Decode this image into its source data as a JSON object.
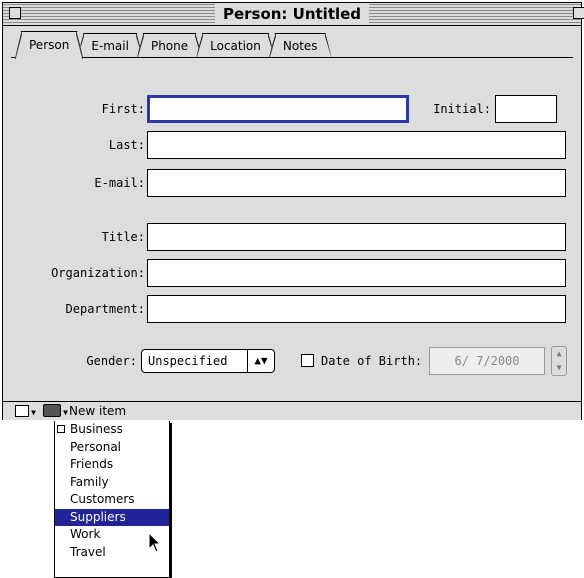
{
  "window": {
    "title": "Person: Untitled",
    "tabs": [
      "Person",
      "E-mail",
      "Phone",
      "Location",
      "Notes"
    ],
    "active_tab": "Person"
  },
  "form": {
    "first_label": "First:",
    "first_value": "",
    "initial_label": "Initial:",
    "initial_value": "",
    "last_label": "Last:",
    "last_value": "",
    "email_label": "E-mail:",
    "email_value": "",
    "title_label": "Title:",
    "title_value": "",
    "organization_label": "Organization:",
    "organization_value": "",
    "department_label": "Department:",
    "department_value": "",
    "gender_label": "Gender:",
    "gender_value": "Unspecified",
    "dob_label": "Date of Birth:",
    "dob_value": "6/ 7/2000",
    "dob_checked": false
  },
  "bottombar": {
    "status_text": "New item"
  },
  "category_menu": {
    "items": [
      "Business",
      "Personal",
      "Friends",
      "Family",
      "Customers",
      "Suppliers",
      "Work",
      "Travel"
    ],
    "checked_item": "Business",
    "highlighted_item": "Suppliers"
  },
  "colors": {
    "window_bg": "#dddddd",
    "focus_ring": "#2c37a8",
    "menu_highlight": "#23239a"
  }
}
